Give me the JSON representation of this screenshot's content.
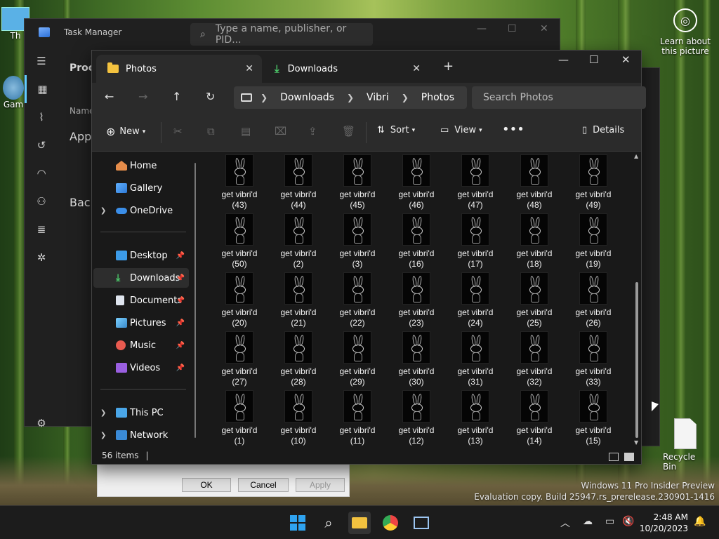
{
  "desktop": {
    "learn_about": "Learn about this picture",
    "recycle_bin": "Recycle Bin",
    "left_icon_1": "Th",
    "left_icon_2": "Gam",
    "watermark_line1": "Windows 11 Pro Insider Preview",
    "watermark_line2": "Evaluation copy. Build 25947.rs_prerelease.230901-1416"
  },
  "task_manager": {
    "title": "Task Manager",
    "search_placeholder": "Type a name, publisher, or PID...",
    "header_proc": "Proce",
    "col_name": "Name",
    "section_apps": "Apps",
    "section_back": "Back"
  },
  "dialog": {
    "ok": "OK",
    "cancel": "Cancel",
    "apply": "Apply"
  },
  "explorer": {
    "tabs": [
      {
        "label": "Photos"
      },
      {
        "label": "Downloads"
      }
    ],
    "breadcrumbs": [
      "Downloads",
      "Vibri",
      "Photos"
    ],
    "search_placeholder": "Search Photos",
    "toolbar": {
      "new": "New",
      "sort": "Sort",
      "view": "View",
      "details": "Details"
    },
    "nav": [
      {
        "label": "Home"
      },
      {
        "label": "Gallery"
      },
      {
        "label": "OneDrive"
      },
      {
        "label": "Desktop"
      },
      {
        "label": "Downloads"
      },
      {
        "label": "Documents"
      },
      {
        "label": "Pictures"
      },
      {
        "label": "Music"
      },
      {
        "label": "Videos"
      },
      {
        "label": "This PC"
      },
      {
        "label": "Network"
      }
    ],
    "files": [
      "(43)",
      "(44)",
      "(45)",
      "(46)",
      "(47)",
      "(48)",
      "(49)",
      "(50)",
      "(2)",
      "(3)",
      "(16)",
      "(17)",
      "(18)",
      "(19)",
      "(20)",
      "(21)",
      "(22)",
      "(23)",
      "(24)",
      "(25)",
      "(26)",
      "(27)",
      "(28)",
      "(29)",
      "(30)",
      "(31)",
      "(32)",
      "(33)",
      "(1)",
      "(10)",
      "(11)",
      "(12)",
      "(13)",
      "(14)",
      "(15)"
    ],
    "file_prefix": "get vibri'd",
    "status": "56 items"
  },
  "taskbar": {
    "time": "2:48 AM",
    "date": "10/20/2023"
  }
}
